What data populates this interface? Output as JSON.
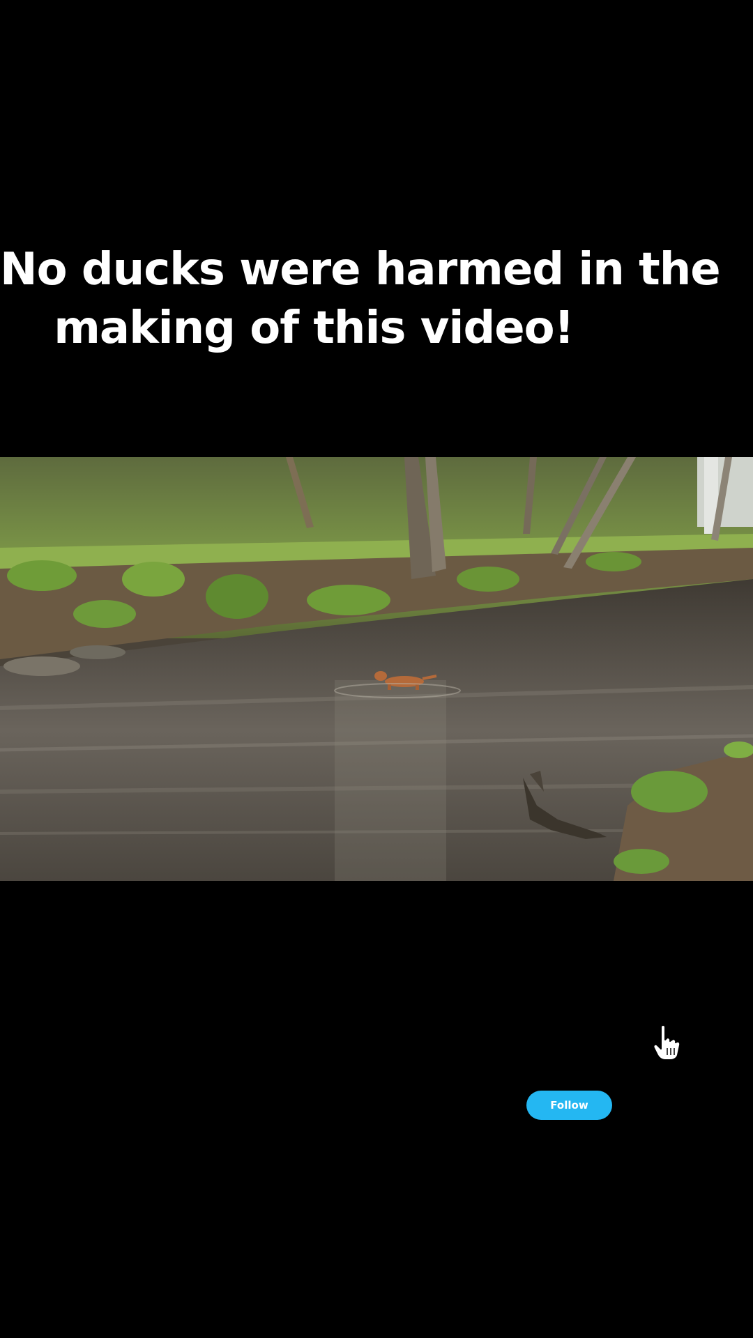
{
  "caption": {
    "line1": "No ducks were harmed in the",
    "line2": "making of this video!"
  },
  "video": {
    "scene": "dog wading in a woodland river"
  },
  "cursor": {
    "icon": "pointer-hand-icon"
  },
  "follow_button": {
    "label": "Follow",
    "color": "#24b7f2"
  },
  "colors": {
    "background": "#000000",
    "caption_text": "#ffffff"
  }
}
